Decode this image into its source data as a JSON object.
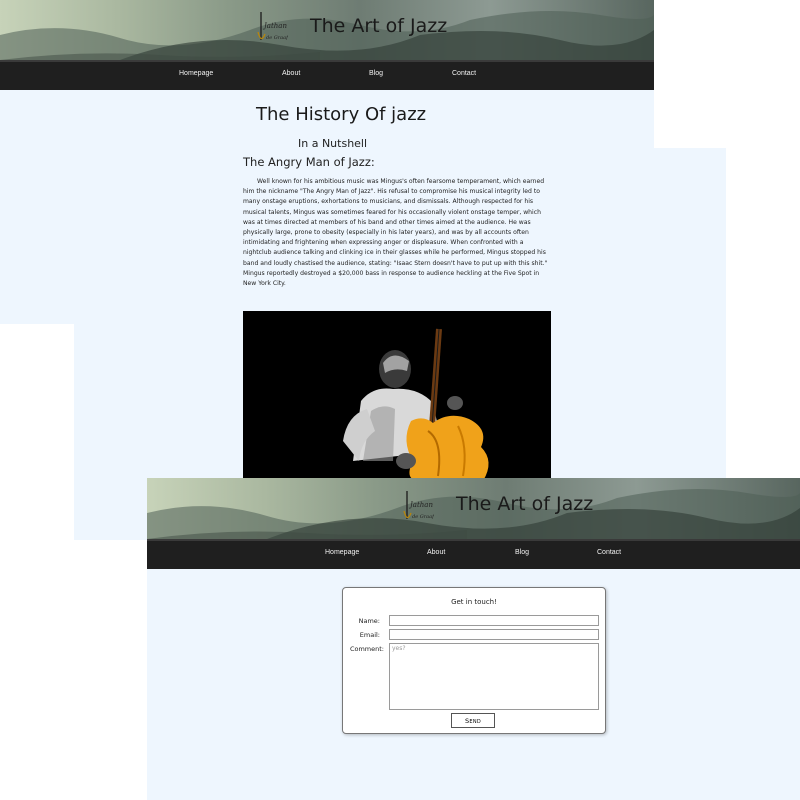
{
  "top_page": {
    "header": {
      "site_title": "The Art of Jazz",
      "logo_text": "Jathan\nde Graaf"
    },
    "nav": {
      "items": [
        "Homepage",
        "About",
        "Blog",
        "Contact"
      ]
    },
    "content": {
      "title": "The History Of jazz",
      "subtitle": "In a Nutshell",
      "section_heading": "The Angry Man of Jazz:",
      "paragraph": "Well known for his ambitious music was Mingus's often fearsome temperament, which earned him the nickname \"The Angry Man of Jazz\". His refusal to compromise his musical integrity led to many onstage eruptions, exhortations to musicians, and dismissals. Although respected for his musical talents, Mingus was sometimes feared for his occasionally violent onstage temper, which was at times directed at members of his band and other times aimed at the audience. He was physically large, prone to obesity (especially in his later years), and was by all accounts often intimidating and frightening when expressing anger or displeasure. When confronted with a nightclub audience talking and clinking ice in their glasses while he performed, Mingus stopped his band and loudly chastised the audience, stating: \"Isaac Stern doesn't have to put up with this shit.\" Mingus reportedly destroyed a $20,000 bass in response to audience heckling at the Five Spot in New York City."
    }
  },
  "contact_page": {
    "header": {
      "site_title": "The Art of Jazz",
      "logo_text": "Jathan\nde Graaf"
    },
    "nav": {
      "items": [
        "Homepage",
        "About",
        "Blog",
        "Contact"
      ]
    },
    "form": {
      "title": "Get in touch!",
      "name_label": "Name:",
      "email_label": "Email:",
      "comment_label": "Comment:",
      "name_value": "",
      "email_value": "",
      "comment_value": "yes?",
      "send_label": "Send"
    }
  },
  "colors": {
    "nav_bg": "#1f1f1f",
    "page_bg": "#eef6fe",
    "accent_orange": "#f0a21a"
  },
  "icons": {
    "logo": "bass-logo-icon",
    "photo": "bassist-photo"
  }
}
